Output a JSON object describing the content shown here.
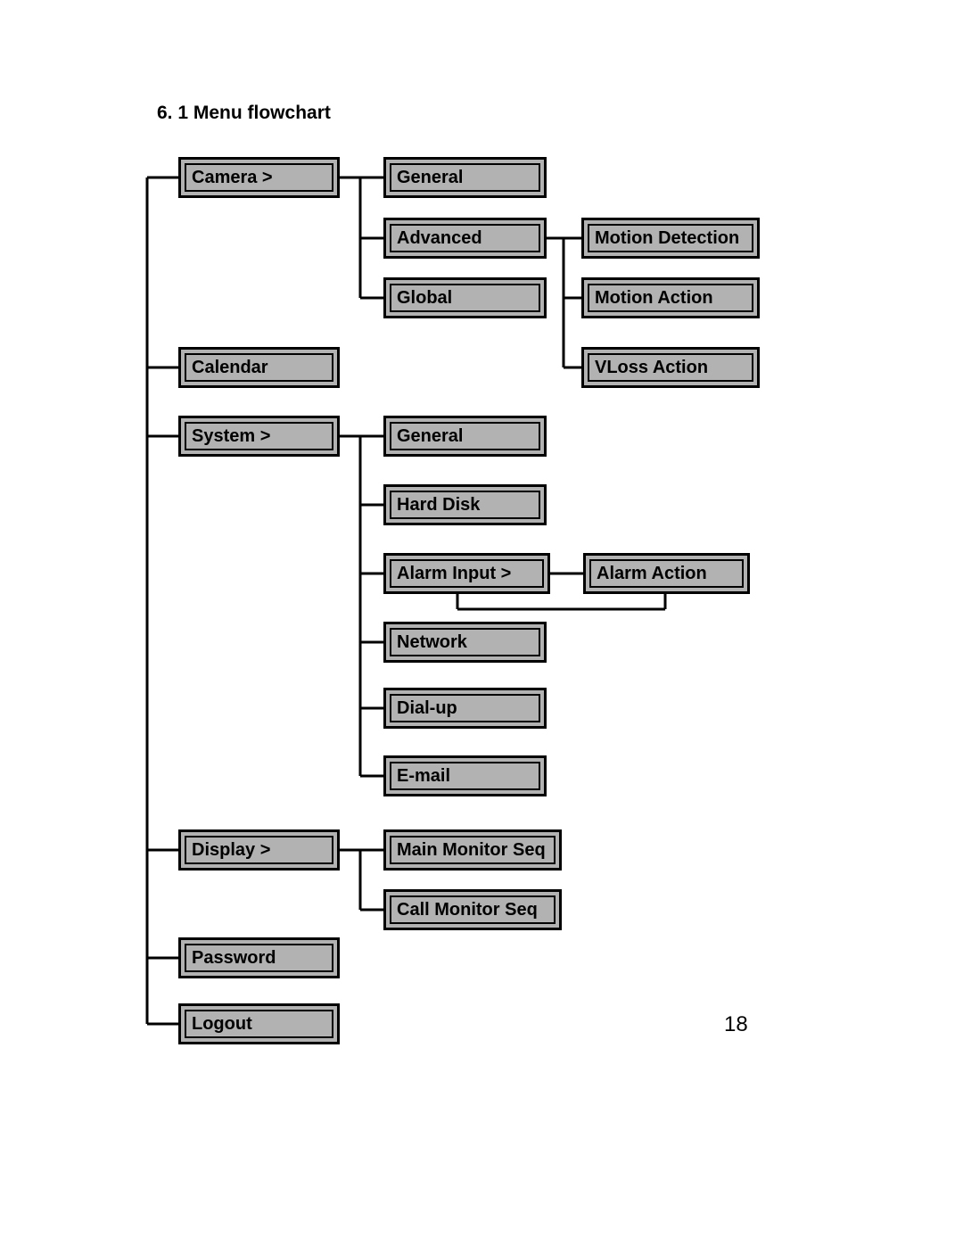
{
  "heading": "6. 1 Menu flowchart",
  "page_number": "18",
  "nodes": {
    "camera": {
      "label": "Camera >"
    },
    "calendar": {
      "label": "Calendar"
    },
    "system": {
      "label": "System >"
    },
    "display": {
      "label": "Display >"
    },
    "password": {
      "label": "Password"
    },
    "logout": {
      "label": "Logout"
    },
    "cam_general": {
      "label": "General"
    },
    "cam_advanced": {
      "label": "Advanced"
    },
    "cam_global": {
      "label": "Global"
    },
    "motion_detection": {
      "label": "Motion Detection"
    },
    "motion_action": {
      "label": "Motion Action"
    },
    "vloss_action": {
      "label": "VLoss Action"
    },
    "sys_general": {
      "label": "General"
    },
    "sys_harddisk": {
      "label": "Hard Disk"
    },
    "sys_alarm_input": {
      "label": "Alarm Input >"
    },
    "sys_network": {
      "label": "Network"
    },
    "sys_dialup": {
      "label": "Dial-up"
    },
    "sys_email": {
      "label": "E-mail"
    },
    "alarm_action": {
      "label": "Alarm Action"
    },
    "disp_main": {
      "label": "Main Monitor Seq"
    },
    "disp_call": {
      "label": "Call Monitor Seq"
    }
  }
}
